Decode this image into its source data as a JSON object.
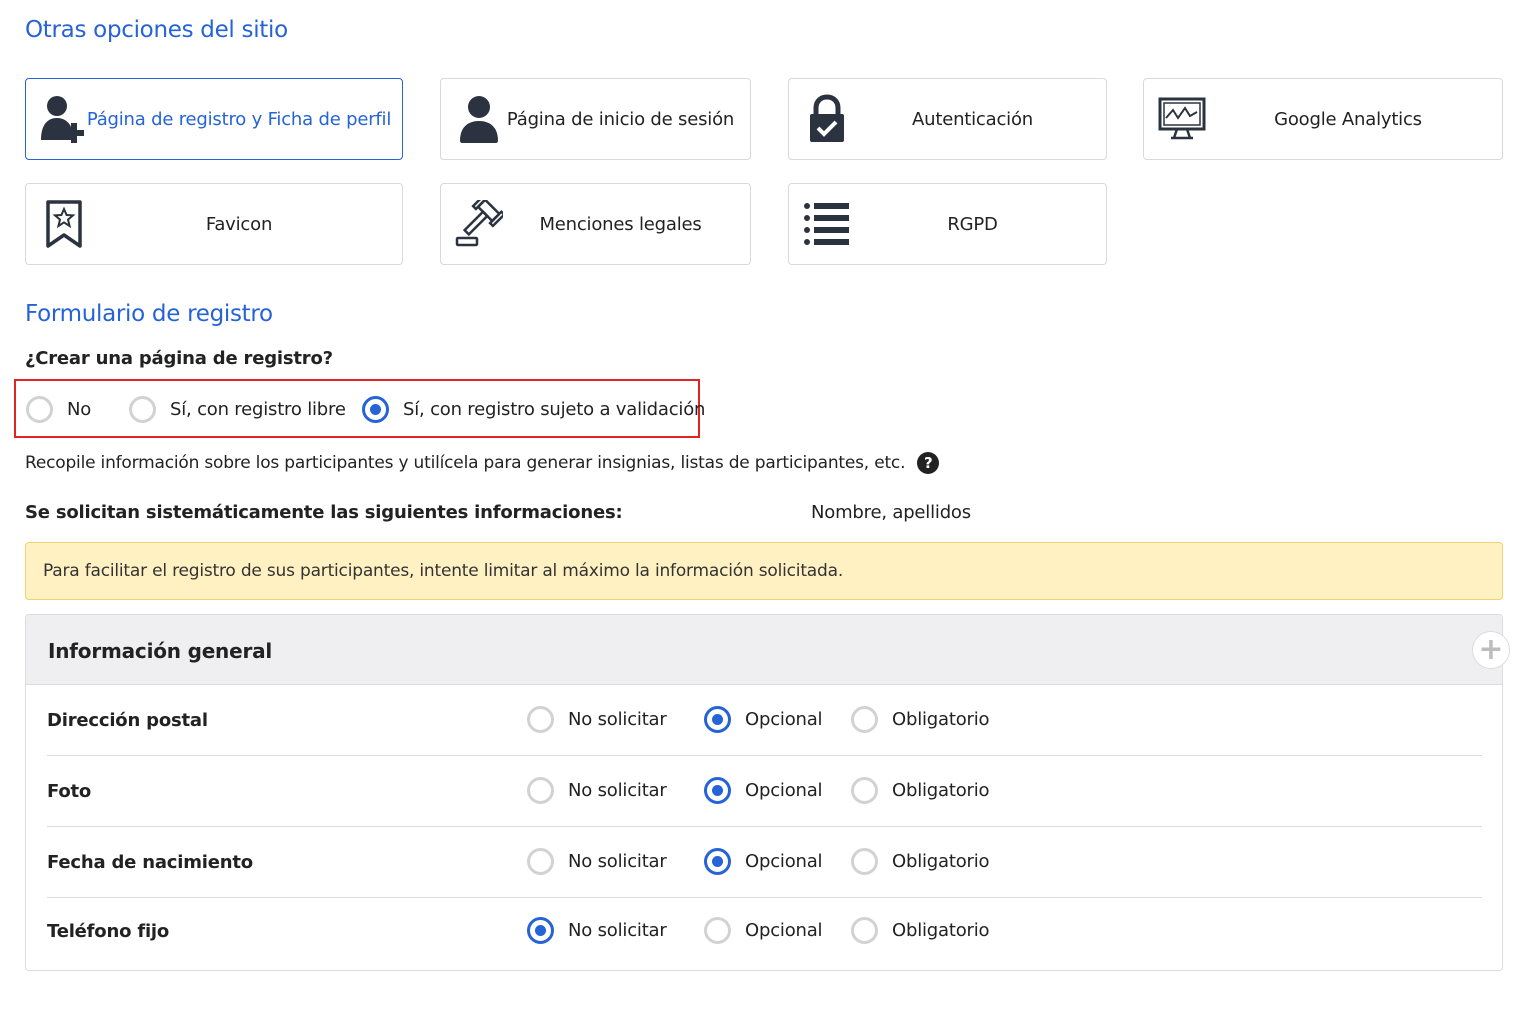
{
  "options_section": {
    "title": "Otras opciones del sitio",
    "cards": [
      {
        "label": "Página de registro y Ficha de perfil",
        "icon": "user-plus-icon",
        "active": true
      },
      {
        "label": "Página de inicio de sesión",
        "icon": "user-icon",
        "active": false
      },
      {
        "label": "Autenticación",
        "icon": "lock-check-icon",
        "active": false
      },
      {
        "label": "Google Analytics",
        "icon": "monitor-chart-icon",
        "active": false
      },
      {
        "label": "Favicon",
        "icon": "bookmark-star-icon",
        "active": false
      },
      {
        "label": "Menciones legales",
        "icon": "gavel-icon",
        "active": false
      },
      {
        "label": "RGPD",
        "icon": "list-icon",
        "active": false
      }
    ]
  },
  "form_section": {
    "title": "Formulario de registro",
    "question": "¿Crear una página de registro?",
    "registration_options": [
      {
        "label": "No",
        "checked": false
      },
      {
        "label": "Sí, con registro libre",
        "checked": false
      },
      {
        "label": "Sí, con registro sujeto a validación",
        "checked": true
      }
    ],
    "description": "Recopile información sobre los participantes y utilícela para generar insignias, listas de participantes, etc.",
    "help_glyph": "?",
    "system_label": "Se solicitan sistemáticamente las siguientes informaciones:",
    "system_value": "Nombre, apellidos",
    "alert": "Para facilitar el registro de sus participantes, intente limitar al máximo la información solicitada."
  },
  "general_panel": {
    "title": "Información general",
    "add_glyph": "+",
    "choices": [
      "No solicitar",
      "Opcional",
      "Obligatorio"
    ],
    "fields": [
      {
        "name": "Dirección postal",
        "selected": "Opcional"
      },
      {
        "name": "Foto",
        "selected": "Opcional"
      },
      {
        "name": "Fecha de nacimiento",
        "selected": "Opcional"
      },
      {
        "name": "Teléfono fijo",
        "selected": "No solicitar"
      }
    ]
  },
  "colors": {
    "accent": "#2563d6",
    "highlight": "#e02424",
    "alert_bg": "#fff1c2",
    "icon": "#2b3340"
  }
}
